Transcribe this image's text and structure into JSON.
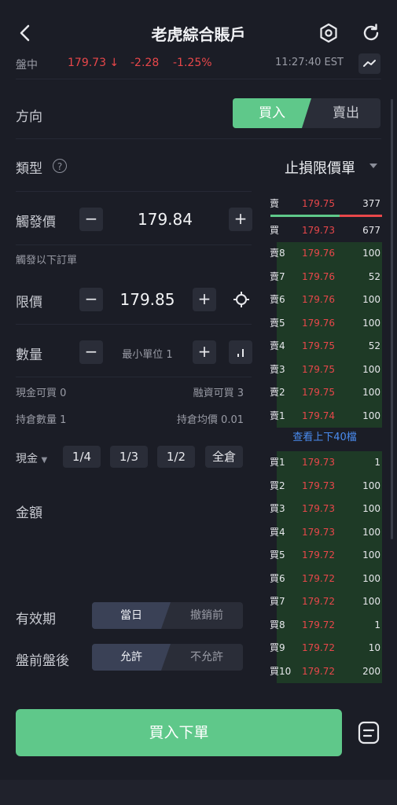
{
  "header": {
    "title": "老虎綜合賬戶"
  },
  "quote": {
    "session": "盤中",
    "price": "179.73 ↓",
    "change": "-2.28",
    "change_pct": "-1.25%",
    "time": "11:27:40 EST"
  },
  "form": {
    "direction_label": "方向",
    "buy_label": "買入",
    "sell_label": "賣出",
    "type_label": "類型",
    "type_help": "?",
    "type_value": "止損限價單",
    "trigger_label": "觸發價",
    "trigger_value": "179.84",
    "trigger_hint": "觸發以下訂單",
    "limit_label": "限價",
    "limit_value": "179.85",
    "qty_label": "數量",
    "qty_placeholder": "最小單位 1",
    "cash_buyable": "現金可買 0",
    "margin_buyable": "融資可買 3",
    "position_qty": "持倉數量 1",
    "position_avg": "持倉均價 0.01",
    "account_type": "現金",
    "fractions": [
      "1/4",
      "1/3",
      "1/2",
      "全倉"
    ],
    "amount_label": "金額",
    "validity_label": "有效期",
    "validity_options": [
      "當日",
      "撤銷前"
    ],
    "extended_label": "盤前盤後",
    "extended_options": [
      "允許",
      "不允許"
    ],
    "submit_label": "買入下單"
  },
  "orderbook": {
    "best_ask": {
      "label": "賣",
      "price": "179.75",
      "qty": "377"
    },
    "best_bid": {
      "label": "買",
      "price": "179.73",
      "qty": "677"
    },
    "asks": [
      {
        "label": "賣8",
        "price": "179.76",
        "qty": "100"
      },
      {
        "label": "賣7",
        "price": "179.76",
        "qty": "52"
      },
      {
        "label": "賣6",
        "price": "179.76",
        "qty": "100"
      },
      {
        "label": "賣5",
        "price": "179.76",
        "qty": "100"
      },
      {
        "label": "賣4",
        "price": "179.75",
        "qty": "52"
      },
      {
        "label": "賣3",
        "price": "179.75",
        "qty": "100"
      },
      {
        "label": "賣2",
        "price": "179.75",
        "qty": "100"
      },
      {
        "label": "賣1",
        "price": "179.74",
        "qty": "100"
      }
    ],
    "view_more": "查看上下40檔",
    "bids": [
      {
        "label": "買1",
        "price": "179.73",
        "qty": "1"
      },
      {
        "label": "買2",
        "price": "179.73",
        "qty": "100"
      },
      {
        "label": "買3",
        "price": "179.73",
        "qty": "100"
      },
      {
        "label": "買4",
        "price": "179.73",
        "qty": "100"
      },
      {
        "label": "買5",
        "price": "179.72",
        "qty": "100"
      },
      {
        "label": "買6",
        "price": "179.72",
        "qty": "100"
      },
      {
        "label": "買7",
        "price": "179.72",
        "qty": "100"
      },
      {
        "label": "買8",
        "price": "179.72",
        "qty": "1"
      },
      {
        "label": "買9",
        "price": "179.72",
        "qty": "10"
      },
      {
        "label": "買10",
        "price": "179.72",
        "qty": "200"
      }
    ]
  },
  "colors": {
    "buy_green": "#5fc88a",
    "down_red": "#e8474a",
    "link_blue": "#4a8cf0",
    "background": "#1b1d26"
  }
}
